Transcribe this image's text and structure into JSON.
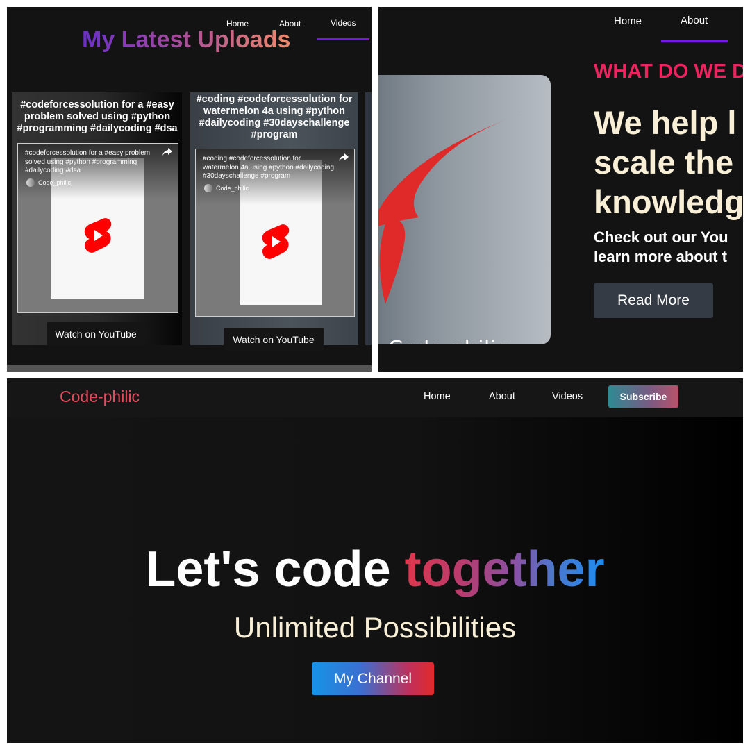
{
  "videos_panel": {
    "nav": [
      {
        "label": "Home"
      },
      {
        "label": "About"
      },
      {
        "label": "Videos"
      }
    ],
    "title": "My Latest Uploads",
    "cards": [
      {
        "title": "#codeforcessolution for a #easy problem solved using #python #programming #dailycoding #dsa",
        "caption": "#codeforcessolution for a #easy problem solved using #python #programming #dailycoding #dsa",
        "channel": "Code_philic",
        "watch_label": "Watch on YouTube"
      },
      {
        "title": "#coding #codeforcessolution for watermelon 4a using #python #dailycoding #30dayschallenge #program",
        "caption": "#coding #codeforcessolution for watermelon 4a using #python #dailycoding #30dayschallenge #program",
        "channel": "Code_philic",
        "watch_label": "Watch on YouTube"
      }
    ]
  },
  "about_panel": {
    "nav": [
      {
        "label": "Home"
      },
      {
        "label": "About"
      }
    ],
    "logo_text": "Code-philic",
    "eyebrow": "WHAT DO WE D",
    "headline": "We help l\nscale the\nknowledg",
    "body": "Check out our You\nlearn more about t",
    "read_more": "Read More"
  },
  "hero_panel": {
    "brand": "Code-philic",
    "nav": [
      {
        "label": "Home"
      },
      {
        "label": "About"
      },
      {
        "label": "Videos"
      }
    ],
    "subscribe": "Subscribe",
    "headline_main": "Let's code ",
    "headline_accent": "together",
    "subheadline": "Unlimited Possibilities",
    "cta": "My Channel"
  },
  "colors": {
    "accent_underline": "#7b14e8",
    "eyebrow_pink": "#ee2460",
    "cream_text": "#f8efd6",
    "brand_red": "#e24d5e"
  },
  "icons": [
    "share-icon",
    "youtube-shorts-icon",
    "code-philic-logo"
  ]
}
